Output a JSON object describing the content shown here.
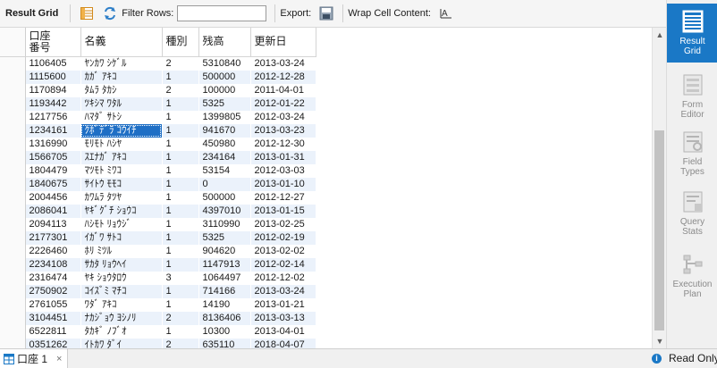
{
  "toolbar": {
    "result_grid_label": "Result Grid",
    "filter_rows_label": "Filter Rows:",
    "filter_value": "",
    "export_label": "Export:",
    "wrap_label": "Wrap Cell Content:"
  },
  "grid": {
    "columns": [
      "口座\n番号",
      "名義",
      "種別",
      "残高",
      "更新日"
    ],
    "rows": [
      [
        "1106405",
        "ﾔﾝｶﾜ ｼｹﾞﾙ",
        "2",
        "5310840",
        "2013-03-24"
      ],
      [
        "1115600",
        "ｶｶﾞ ｱｷｺ",
        "1",
        "500000",
        "2012-12-28"
      ],
      [
        "1170894",
        "ﾀﾑﾗ ﾀｶｼ",
        "2",
        "100000",
        "2011-04-01"
      ],
      [
        "1193442",
        "ﾂｷｼﾏ ﾜﾀﾙ",
        "1",
        "5325",
        "2012-01-22"
      ],
      [
        "1217756",
        "ﾊﾏﾀﾞ ｻﾄｼ",
        "1",
        "1399805",
        "2012-03-24"
      ],
      [
        "1234161",
        "ｸﾎﾞﾃﾞﾗ ｺｳｲﾁ",
        "1",
        "941670",
        "2013-03-23"
      ],
      [
        "1316990",
        "ﾓﾘﾓﾄ ﾊｼﾔ",
        "1",
        "450980",
        "2012-12-30"
      ],
      [
        "1566705",
        "ｽｴﾅｶﾞ ｱｷｺ",
        "1",
        "234164",
        "2013-01-31"
      ],
      [
        "1804479",
        "ﾏﾂﾓﾄ ﾐﾜｺ",
        "1",
        "53154",
        "2012-03-03"
      ],
      [
        "1840675",
        "ｻｲﾄｳ ﾓﾓｺ",
        "1",
        "0",
        "2013-01-10"
      ],
      [
        "2004456",
        "ｶﾜﾑﾗ ﾀﾂﾔ",
        "1",
        "500000",
        "2012-12-27"
      ],
      [
        "2086041",
        "ﾔｷﾞｸﾞﾁ ｼｮｳｺ",
        "1",
        "4397010",
        "2013-01-15"
      ],
      [
        "2094113",
        "ﾊｼﾓﾄ ﾘｮｳｼﾞ",
        "1",
        "3110990",
        "2013-02-25"
      ],
      [
        "2177301",
        "ｲｶﾞﾜ ｻﾄｺ",
        "1",
        "5325",
        "2012-02-19"
      ],
      [
        "2226460",
        "ﾎﾘ ﾐﾂﾙ",
        "1",
        "904620",
        "2013-02-02"
      ],
      [
        "2234108",
        "ｻｶﾀ ﾘｮｳﾍｲ",
        "1",
        "1147913",
        "2012-02-14"
      ],
      [
        "2316474",
        "ﾔｷ ｼｮｳﾀﾛｳ",
        "3",
        "1064497",
        "2012-12-02"
      ],
      [
        "2750902",
        "ｺｲｽﾞﾐ ﾏﾁｺ",
        "1",
        "714166",
        "2013-03-24"
      ],
      [
        "2761055",
        "ﾜﾀﾞ ｱｷｺ",
        "1",
        "14190",
        "2013-01-21"
      ],
      [
        "3104451",
        "ﾅｶｼﾞｮｳ ﾖｼﾉﾘ",
        "2",
        "8136406",
        "2013-03-13"
      ],
      [
        "6522811",
        "ﾀｶｷﾞ ﾉﾌﾞｵ",
        "1",
        "10300",
        "2013-04-01"
      ],
      [
        "0351262",
        "ｲﾄｶﾜ ﾀﾞｲ",
        "2",
        "635110",
        "2018-04-07"
      ]
    ],
    "selected_cell": {
      "row": 5,
      "col": 1
    }
  },
  "side_panel": {
    "buttons": [
      {
        "id": "result-grid",
        "label": "Result\nGrid",
        "icon": "result-grid-icon",
        "active": true
      },
      {
        "id": "form-editor",
        "label": "Form\nEditor",
        "icon": "form-editor-icon",
        "active": false
      },
      {
        "id": "field-types",
        "label": "Field\nTypes",
        "icon": "field-types-icon",
        "active": false
      },
      {
        "id": "query-stats",
        "label": "Query\nStats",
        "icon": "query-stats-icon",
        "active": false
      },
      {
        "id": "execution-plan",
        "label": "Execution\nPlan",
        "icon": "execution-plan-icon",
        "active": false
      }
    ]
  },
  "status_bar": {
    "tab_label": "口座 1",
    "tab_close": "×",
    "read_only": "Read Only"
  },
  "colors": {
    "accent": "#1a78c6",
    "selection": "#1f6fc5",
    "alt_row": "#ebf2fb"
  }
}
